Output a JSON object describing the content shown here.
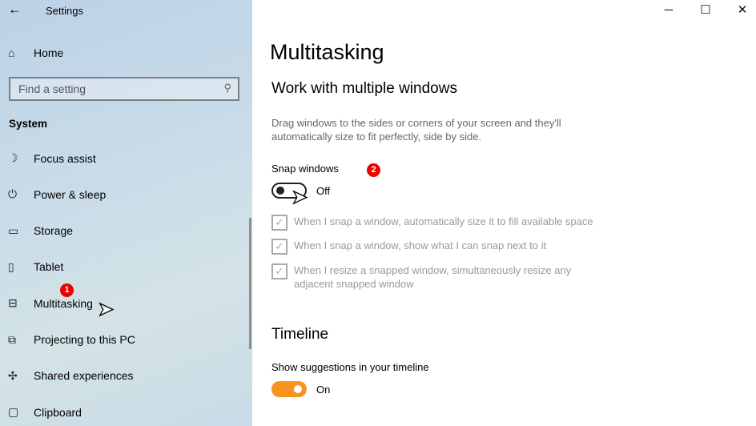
{
  "window": {
    "title": "Settings",
    "minimize": "─",
    "maximize": "☐",
    "close": "✕"
  },
  "sidebar": {
    "home": "Home",
    "search_placeholder": "Find a setting",
    "section": "System",
    "items": [
      {
        "label": "Focus assist",
        "icon": "moon-icon",
        "glyph": "☽"
      },
      {
        "label": "Power & sleep",
        "icon": "power-icon",
        "glyph": "⏻"
      },
      {
        "label": "Storage",
        "icon": "storage-icon",
        "glyph": "▭"
      },
      {
        "label": "Tablet",
        "icon": "tablet-icon",
        "glyph": "▯"
      },
      {
        "label": "Multitasking",
        "icon": "multitasking-icon",
        "glyph": "⊟"
      },
      {
        "label": "Projecting to this PC",
        "icon": "projecting-icon",
        "glyph": "⧉"
      },
      {
        "label": "Shared experiences",
        "icon": "shared-icon",
        "glyph": "✣"
      },
      {
        "label": "Clipboard",
        "icon": "clipboard-icon",
        "glyph": "▢"
      }
    ],
    "selected": "Multitasking"
  },
  "main": {
    "title": "Multitasking",
    "section1": "Work with multiple windows",
    "description": "Drag windows to the sides or corners of your screen and they'll automatically size to fit perfectly, side by side.",
    "snap_label": "Snap windows",
    "snap_state": "Off",
    "options": [
      "When I snap a window, automatically size it to fill available space",
      "When I snap a window, show what I can snap next to it",
      "When I resize a snapped window, simultaneously resize any adjacent snapped window"
    ],
    "section2": "Timeline",
    "timeline_label": "Show suggestions in your timeline",
    "timeline_state": "On"
  },
  "annotations": {
    "step1": "1",
    "step2": "2"
  },
  "colors": {
    "accent": "#f7941d",
    "badge": "#e00000"
  }
}
